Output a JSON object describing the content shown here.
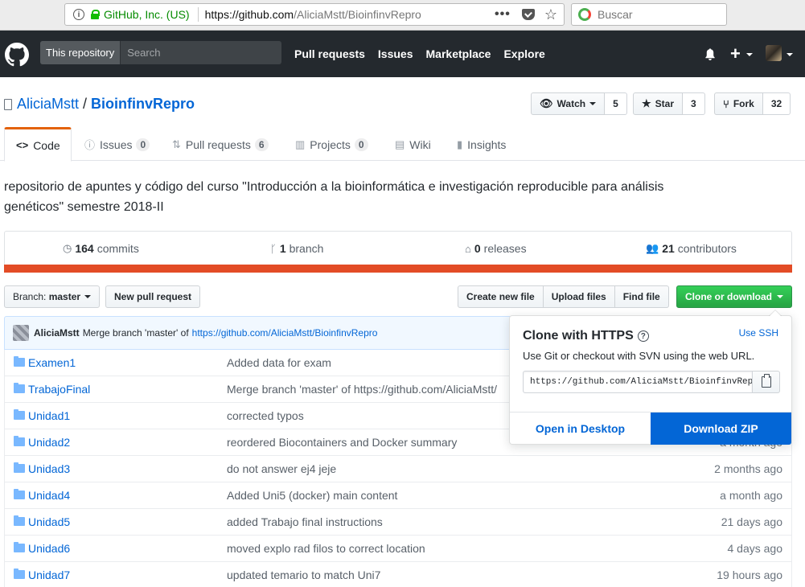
{
  "browser": {
    "company": "GitHub, Inc. (US)",
    "url_host": "https://github.com",
    "url_path": "/AliciaMstt/BioinfinvRepro",
    "more": "•••",
    "search_placeholder": "Buscar"
  },
  "header": {
    "scope": "This repository",
    "search_placeholder": "Search",
    "nav": [
      "Pull requests",
      "Issues",
      "Marketplace",
      "Explore"
    ],
    "plus": "+"
  },
  "repo": {
    "owner": "AliciaMstt",
    "slash": "/",
    "name": "BioinfinvRepro",
    "watch_label": "Watch",
    "watch_count": "5",
    "star_label": "Star",
    "star_count": "3",
    "fork_label": "Fork",
    "fork_count": "32",
    "description": "repositorio de apuntes y código del curso \"Introducción a la bioinformática e investigación reproducible para análisis genéticos\" semestre 2018-II"
  },
  "tabs": {
    "code": "Code",
    "issues": "Issues",
    "issues_count": "0",
    "pulls": "Pull requests",
    "pulls_count": "6",
    "projects": "Projects",
    "projects_count": "0",
    "wiki": "Wiki",
    "insights": "Insights"
  },
  "summary": {
    "commits_num": "164",
    "commits_label": "commits",
    "branch_num": "1",
    "branch_label": "branch",
    "releases_num": "0",
    "releases_label": "releases",
    "contributors_num": "21",
    "contributors_label": "contributors"
  },
  "toolbar": {
    "branch_prefix": "Branch:",
    "branch_name": "master",
    "new_pr": "New pull request",
    "create_file": "Create new file",
    "upload_files": "Upload files",
    "find_file": "Find file",
    "clone": "Clone or download"
  },
  "commit": {
    "author": "AliciaMstt",
    "message": "Merge branch 'master' of",
    "link": "https://github.com/AliciaMstt/BioinfinvRepro"
  },
  "files": [
    {
      "name": "Examen1",
      "message": "Added data for exam",
      "age": ""
    },
    {
      "name": "TrabajoFinal",
      "message": "Merge branch 'master' of https://github.com/AliciaMstt/",
      "age": ""
    },
    {
      "name": "Unidad1",
      "message": "corrected typos",
      "age": ""
    },
    {
      "name": "Unidad2",
      "message": "reordered Biocontainers and Docker summary",
      "age": "a month ago"
    },
    {
      "name": "Unidad3",
      "message": "do not answer ej4 jeje",
      "age": "2 months ago"
    },
    {
      "name": "Unidad4",
      "message": "Added Uni5 (docker) main content",
      "age": "a month ago"
    },
    {
      "name": "Unidad5",
      "message": "added Trabajo final instructions",
      "age": "21 days ago"
    },
    {
      "name": "Unidad6",
      "message": "moved explo rad filos to correct location",
      "age": "4 days ago"
    },
    {
      "name": "Unidad7",
      "message": "updated temario to match Uni7",
      "age": "19 hours ago"
    }
  ],
  "clone_popup": {
    "title": "Clone with HTTPS",
    "help": "?",
    "use_ssh": "Use SSH",
    "description": "Use Git or checkout with SVN using the web URL.",
    "url": "https://github.com/AliciaMstt/BioinfinvRepro.git",
    "open_desktop": "Open in Desktop",
    "download_zip": "Download ZIP"
  },
  "colors": {
    "accent_tab": "#e36209",
    "language_bar": "#e34c26",
    "clone_button": "#28a745",
    "download_zip": "#0366d6",
    "link": "#0366d6"
  }
}
